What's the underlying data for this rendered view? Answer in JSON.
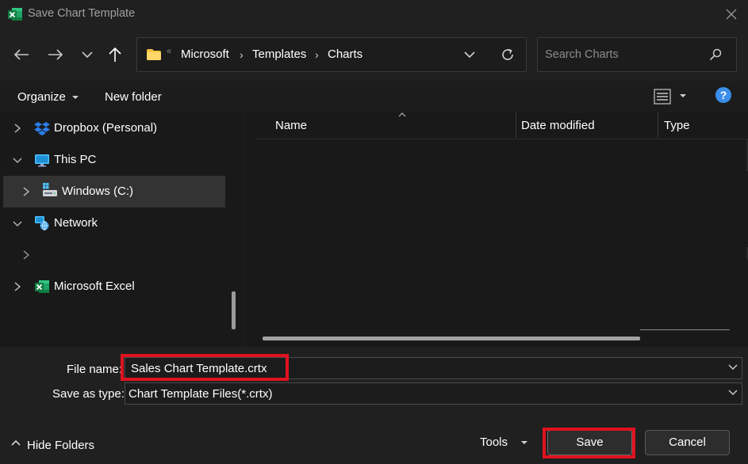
{
  "window": {
    "title": "Save Chart Template"
  },
  "address": {
    "crumbs": [
      "Microsoft",
      "Templates",
      "Charts"
    ],
    "overflow": "«"
  },
  "search": {
    "placeholder": "Search Charts"
  },
  "toolbar": {
    "organize_label": "Organize",
    "new_folder_label": "New folder",
    "help_label": "?"
  },
  "sidebar": {
    "items": [
      {
        "label": "Dropbox (Personal)",
        "icon": "dropbox-icon",
        "expanded": false
      },
      {
        "label": "This PC",
        "icon": "monitor-icon",
        "expanded": true
      },
      {
        "label": "Windows (C:)",
        "icon": "drive-icon",
        "expanded": false,
        "selected": true
      },
      {
        "label": "Network",
        "icon": "network-icon",
        "expanded": true
      },
      {
        "label": "",
        "icon": "",
        "expanded": false
      },
      {
        "label": "Microsoft Excel",
        "icon": "excel-icon",
        "expanded": false
      }
    ]
  },
  "columns": {
    "name": "Name",
    "date_modified": "Date modified",
    "type": "Type"
  },
  "footer": {
    "file_name_label": "File name:",
    "file_name_value": "Sales Chart Template.crtx",
    "save_type_label": "Save as type:",
    "save_type_value": "Chart Template Files(*.crtx)",
    "hide_folders_label": "Hide Folders",
    "tools_label": "Tools",
    "save_label": "Save",
    "cancel_label": "Cancel"
  },
  "colors": {
    "highlight": "#e0121f",
    "accent": "#3b8eea",
    "folder": "#f5c342"
  }
}
